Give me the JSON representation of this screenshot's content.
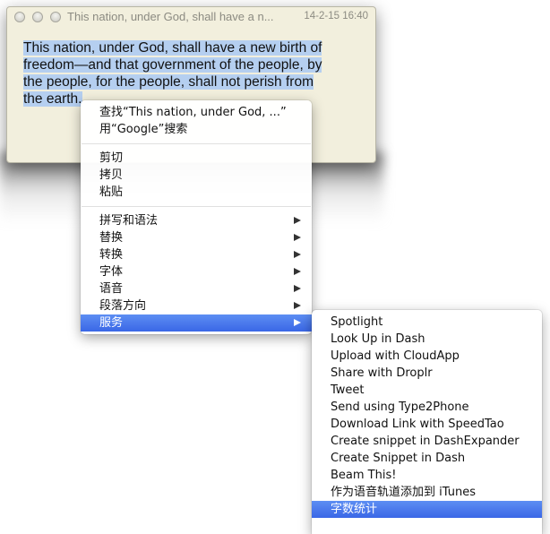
{
  "window": {
    "title": "This nation, under God, shall have a n...",
    "date": "14-2-15 16:40",
    "body_lines": [
      "This nation, under God, shall have a new birth of",
      "freedom—and that government of the people, by",
      "the people, for the people, shall not perish from",
      "the earth."
    ],
    "selection_color": "#b5cff0"
  },
  "context_menu": {
    "groups": [
      [
        {
          "label": "查找“This nation, under God, ...”",
          "submenu": false
        },
        {
          "label": "用“Google”搜索",
          "submenu": false
        }
      ],
      [
        {
          "label": "剪切",
          "submenu": false
        },
        {
          "label": "拷贝",
          "submenu": false
        },
        {
          "label": "粘贴",
          "submenu": false
        }
      ],
      [
        {
          "label": "拼写和语法",
          "submenu": true
        },
        {
          "label": "替换",
          "submenu": true
        },
        {
          "label": "转换",
          "submenu": true
        },
        {
          "label": "字体",
          "submenu": true
        },
        {
          "label": "语音",
          "submenu": true
        },
        {
          "label": "段落方向",
          "submenu": true
        },
        {
          "label": "服务",
          "submenu": true,
          "selected": true
        }
      ]
    ]
  },
  "services_menu": {
    "items": [
      {
        "label": "Spotlight"
      },
      {
        "label": "Look Up in Dash"
      },
      {
        "label": "Upload with CloudApp"
      },
      {
        "label": "Share with Droplr"
      },
      {
        "label": "Tweet"
      },
      {
        "label": "Send using Type2Phone"
      },
      {
        "label": "Download Link with SpeedTao"
      },
      {
        "label": "Create snippet in DashExpander"
      },
      {
        "label": "Create Snippet in Dash"
      },
      {
        "label": "Beam This!"
      },
      {
        "label": "作为语音轨道添加到 iTunes"
      },
      {
        "label": "字数统计",
        "selected": true
      }
    ]
  },
  "colors": {
    "highlight": "#3a67e6",
    "note_background": "#f2efdd"
  }
}
